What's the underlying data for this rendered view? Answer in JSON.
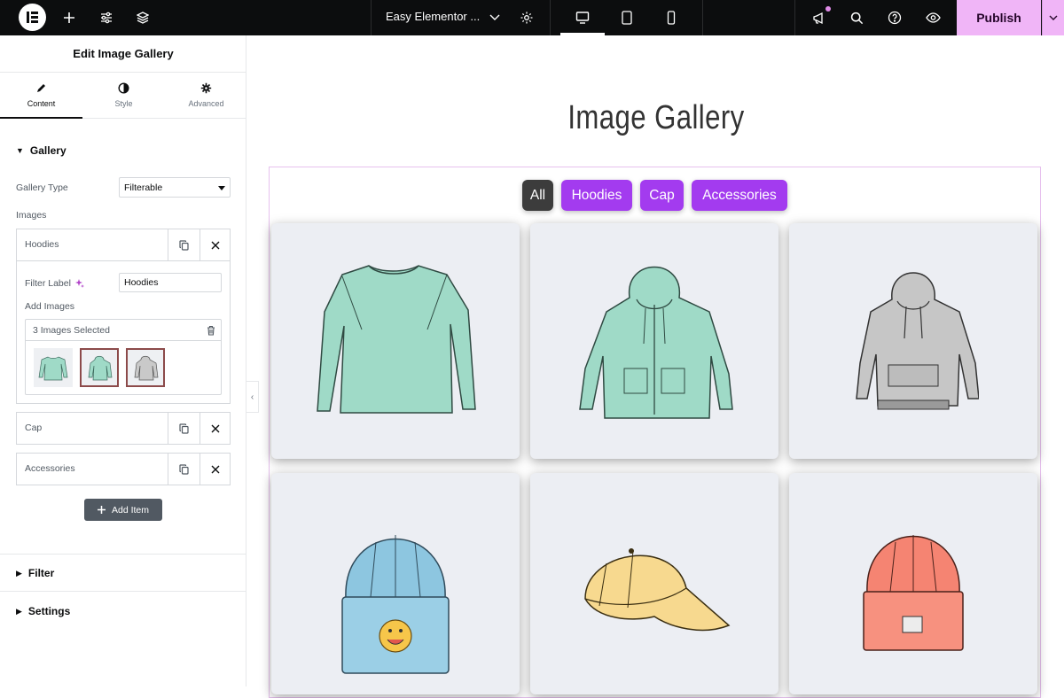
{
  "topbar": {
    "document_title": "Easy Elementor ...",
    "publish_label": "Publish"
  },
  "panel": {
    "title": "Edit Image Gallery",
    "tabs": [
      {
        "label": "Content"
      },
      {
        "label": "Style"
      },
      {
        "label": "Advanced"
      }
    ],
    "gallery_section": "Gallery",
    "gallery_type_label": "Gallery Type",
    "gallery_type_value": "Filterable",
    "images_label": "Images",
    "items": [
      {
        "name": "Hoodies"
      },
      {
        "name": "Cap"
      },
      {
        "name": "Accessories"
      }
    ],
    "filter_label_text": "Filter Label",
    "filter_label_value": "Hoodies",
    "add_images_label": "Add Images",
    "images_selected": "3 Images Selected",
    "add_item_label": "Add Item",
    "filter_section": "Filter",
    "settings_section": "Settings"
  },
  "canvas": {
    "heading": "Image Gallery",
    "filters": [
      "All",
      "Hoodies",
      "Cap",
      "Accessories"
    ],
    "gallery_items": [
      {
        "name": "mint-sweatshirt-image"
      },
      {
        "name": "mint-zip-hoodie-image"
      },
      {
        "name": "grey-hoodie-image"
      },
      {
        "name": "blue-beanie-image"
      },
      {
        "name": "yellow-cap-image"
      },
      {
        "name": "coral-beanie-image"
      }
    ]
  },
  "colors": {
    "accent": "#a33bef",
    "active_filter": "#3c3c3c",
    "publish_bg": "#f0b5f7",
    "topbar_bg": "#0c0d0e"
  }
}
